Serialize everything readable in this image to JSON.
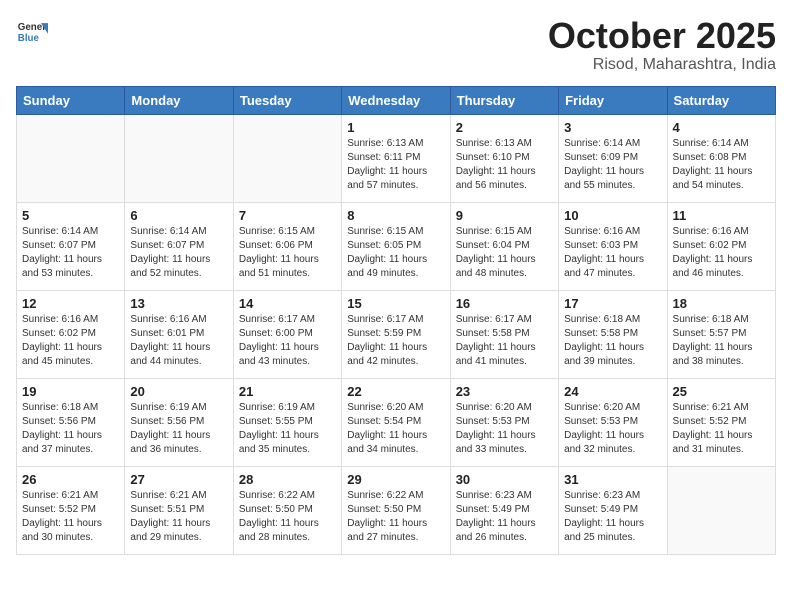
{
  "header": {
    "logo_general": "General",
    "logo_blue": "Blue",
    "month_title": "October 2025",
    "subtitle": "Risod, Maharashtra, India"
  },
  "weekdays": [
    "Sunday",
    "Monday",
    "Tuesday",
    "Wednesday",
    "Thursday",
    "Friday",
    "Saturday"
  ],
  "weeks": [
    [
      {
        "day": "",
        "info": ""
      },
      {
        "day": "",
        "info": ""
      },
      {
        "day": "",
        "info": ""
      },
      {
        "day": "1",
        "info": "Sunrise: 6:13 AM\nSunset: 6:11 PM\nDaylight: 11 hours\nand 57 minutes."
      },
      {
        "day": "2",
        "info": "Sunrise: 6:13 AM\nSunset: 6:10 PM\nDaylight: 11 hours\nand 56 minutes."
      },
      {
        "day": "3",
        "info": "Sunrise: 6:14 AM\nSunset: 6:09 PM\nDaylight: 11 hours\nand 55 minutes."
      },
      {
        "day": "4",
        "info": "Sunrise: 6:14 AM\nSunset: 6:08 PM\nDaylight: 11 hours\nand 54 minutes."
      }
    ],
    [
      {
        "day": "5",
        "info": "Sunrise: 6:14 AM\nSunset: 6:07 PM\nDaylight: 11 hours\nand 53 minutes."
      },
      {
        "day": "6",
        "info": "Sunrise: 6:14 AM\nSunset: 6:07 PM\nDaylight: 11 hours\nand 52 minutes."
      },
      {
        "day": "7",
        "info": "Sunrise: 6:15 AM\nSunset: 6:06 PM\nDaylight: 11 hours\nand 51 minutes."
      },
      {
        "day": "8",
        "info": "Sunrise: 6:15 AM\nSunset: 6:05 PM\nDaylight: 11 hours\nand 49 minutes."
      },
      {
        "day": "9",
        "info": "Sunrise: 6:15 AM\nSunset: 6:04 PM\nDaylight: 11 hours\nand 48 minutes."
      },
      {
        "day": "10",
        "info": "Sunrise: 6:16 AM\nSunset: 6:03 PM\nDaylight: 11 hours\nand 47 minutes."
      },
      {
        "day": "11",
        "info": "Sunrise: 6:16 AM\nSunset: 6:02 PM\nDaylight: 11 hours\nand 46 minutes."
      }
    ],
    [
      {
        "day": "12",
        "info": "Sunrise: 6:16 AM\nSunset: 6:02 PM\nDaylight: 11 hours\nand 45 minutes."
      },
      {
        "day": "13",
        "info": "Sunrise: 6:16 AM\nSunset: 6:01 PM\nDaylight: 11 hours\nand 44 minutes."
      },
      {
        "day": "14",
        "info": "Sunrise: 6:17 AM\nSunset: 6:00 PM\nDaylight: 11 hours\nand 43 minutes."
      },
      {
        "day": "15",
        "info": "Sunrise: 6:17 AM\nSunset: 5:59 PM\nDaylight: 11 hours\nand 42 minutes."
      },
      {
        "day": "16",
        "info": "Sunrise: 6:17 AM\nSunset: 5:58 PM\nDaylight: 11 hours\nand 41 minutes."
      },
      {
        "day": "17",
        "info": "Sunrise: 6:18 AM\nSunset: 5:58 PM\nDaylight: 11 hours\nand 39 minutes."
      },
      {
        "day": "18",
        "info": "Sunrise: 6:18 AM\nSunset: 5:57 PM\nDaylight: 11 hours\nand 38 minutes."
      }
    ],
    [
      {
        "day": "19",
        "info": "Sunrise: 6:18 AM\nSunset: 5:56 PM\nDaylight: 11 hours\nand 37 minutes."
      },
      {
        "day": "20",
        "info": "Sunrise: 6:19 AM\nSunset: 5:56 PM\nDaylight: 11 hours\nand 36 minutes."
      },
      {
        "day": "21",
        "info": "Sunrise: 6:19 AM\nSunset: 5:55 PM\nDaylight: 11 hours\nand 35 minutes."
      },
      {
        "day": "22",
        "info": "Sunrise: 6:20 AM\nSunset: 5:54 PM\nDaylight: 11 hours\nand 34 minutes."
      },
      {
        "day": "23",
        "info": "Sunrise: 6:20 AM\nSunset: 5:53 PM\nDaylight: 11 hours\nand 33 minutes."
      },
      {
        "day": "24",
        "info": "Sunrise: 6:20 AM\nSunset: 5:53 PM\nDaylight: 11 hours\nand 32 minutes."
      },
      {
        "day": "25",
        "info": "Sunrise: 6:21 AM\nSunset: 5:52 PM\nDaylight: 11 hours\nand 31 minutes."
      }
    ],
    [
      {
        "day": "26",
        "info": "Sunrise: 6:21 AM\nSunset: 5:52 PM\nDaylight: 11 hours\nand 30 minutes."
      },
      {
        "day": "27",
        "info": "Sunrise: 6:21 AM\nSunset: 5:51 PM\nDaylight: 11 hours\nand 29 minutes."
      },
      {
        "day": "28",
        "info": "Sunrise: 6:22 AM\nSunset: 5:50 PM\nDaylight: 11 hours\nand 28 minutes."
      },
      {
        "day": "29",
        "info": "Sunrise: 6:22 AM\nSunset: 5:50 PM\nDaylight: 11 hours\nand 27 minutes."
      },
      {
        "day": "30",
        "info": "Sunrise: 6:23 AM\nSunset: 5:49 PM\nDaylight: 11 hours\nand 26 minutes."
      },
      {
        "day": "31",
        "info": "Sunrise: 6:23 AM\nSunset: 5:49 PM\nDaylight: 11 hours\nand 25 minutes."
      },
      {
        "day": "",
        "info": ""
      }
    ]
  ]
}
